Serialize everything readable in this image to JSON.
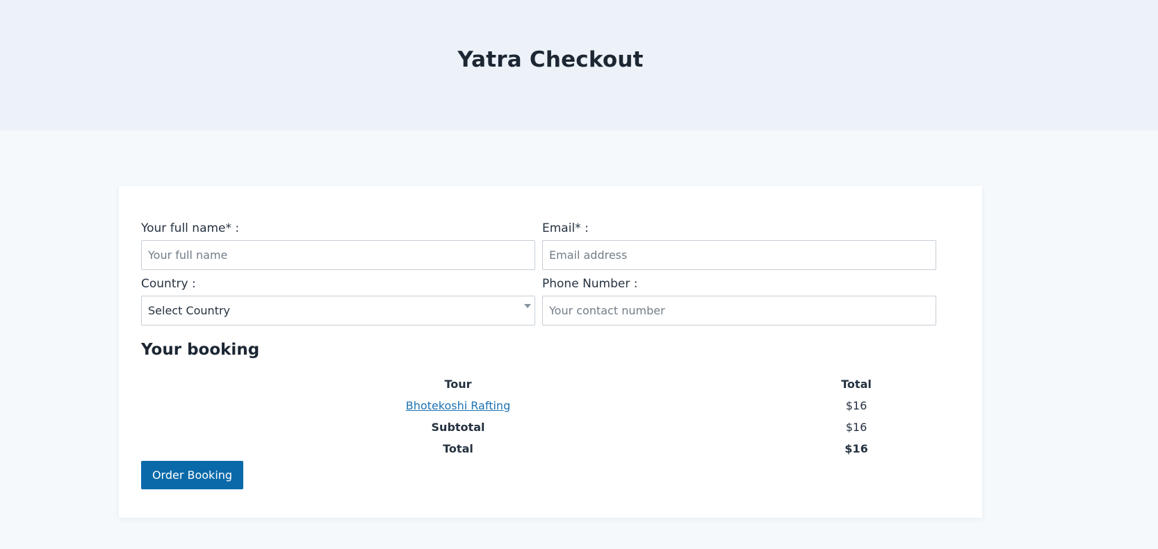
{
  "header": {
    "title": "Yatra Checkout"
  },
  "form": {
    "full_name": {
      "label": "Your full name* :",
      "placeholder": "Your full name",
      "value": ""
    },
    "email": {
      "label": "Email* :",
      "placeholder": "Email address",
      "value": ""
    },
    "country": {
      "label": "Country :",
      "selected": "Select Country"
    },
    "phone": {
      "label": "Phone Number :",
      "placeholder": "Your contact number",
      "value": ""
    }
  },
  "booking": {
    "heading": "Your booking",
    "columns": {
      "tour": "Tour",
      "total": "Total"
    },
    "item": {
      "tour": "Bhotekoshi Rafting",
      "total": "$16"
    },
    "subtotal": {
      "label": "Subtotal",
      "value": "$16"
    },
    "grand_total": {
      "label": "Total",
      "value": "$16"
    }
  },
  "actions": {
    "order_label": "Order Booking"
  },
  "colors": {
    "header_bg": "#edf2f9",
    "page_bg": "#f5f9fc",
    "card_bg": "#ffffff",
    "primary_button": "#0a6aa9",
    "link": "#1c72b3",
    "text": "#253240"
  }
}
